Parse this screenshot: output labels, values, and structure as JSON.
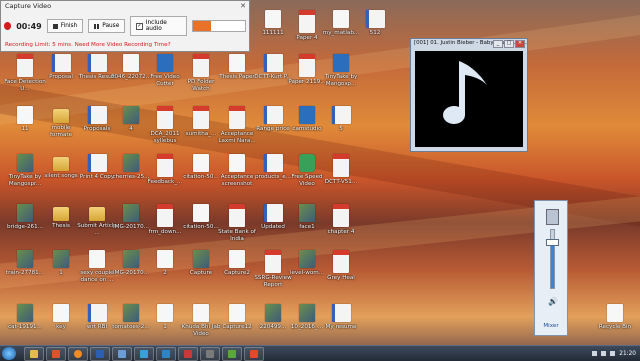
{
  "capture": {
    "title": "Capture Video",
    "timer": "00:49",
    "finish": "Finish",
    "pause": "Pause",
    "include_audio": "Include audio",
    "audio_level": 0.35,
    "limit_notice": "Recording Limit: 5 mins. Need More Video Recording Time?"
  },
  "player": {
    "title": "[001] 01. Justin Bieber - Baby (feat Luda...",
    "colors": {
      "bg": "#000000",
      "note": "#dfe9f5"
    }
  },
  "mixer": {
    "label": "Mixer",
    "level": 0.8
  },
  "desktop_icons": [
    {
      "label": "111111",
      "type": "white"
    },
    {
      "label": "Paper 4",
      "type": "pdf"
    },
    {
      "label": "my_matlab...",
      "type": "white"
    },
    {
      "label": "512",
      "type": "doc"
    },
    {
      "label": "Face Detection U...",
      "type": "pdf"
    },
    {
      "label": "Proposal",
      "type": "doc"
    },
    {
      "label": "Thesis Result",
      "type": "doc"
    },
    {
      "label": "8046_22072...",
      "type": "white"
    },
    {
      "label": "Free Video Cutter",
      "type": "app"
    },
    {
      "label": "PD Folder Watch",
      "type": "pdf"
    },
    {
      "label": "Thesis Paper",
      "type": "white"
    },
    {
      "label": "DCTT-Kurt P...",
      "type": "doc"
    },
    {
      "label": "Paper 2119...",
      "type": "pdf"
    },
    {
      "label": "TinyTake by Mangosp...",
      "type": "app"
    },
    {
      "label": "11",
      "type": "white"
    },
    {
      "label": "mobile formate",
      "type": "folder"
    },
    {
      "label": "Proposals",
      "type": "doc"
    },
    {
      "label": "4",
      "type": "img"
    },
    {
      "label": "DCA_2011 syllebus",
      "type": "pdf"
    },
    {
      "label": "sumitha_...",
      "type": "pdf"
    },
    {
      "label": "Acceptance Laxmi Nara...",
      "type": "pdf"
    },
    {
      "label": "Range price",
      "type": "doc"
    },
    {
      "label": "camstudio",
      "type": "app"
    },
    {
      "label": "5",
      "type": "doc"
    },
    {
      "label": "TinyTake by Mangospr...",
      "type": "img"
    },
    {
      "label": "silent songs",
      "type": "folder"
    },
    {
      "label": "Print 4 Copy",
      "type": "doc"
    },
    {
      "label": "cherries-25...",
      "type": "img"
    },
    {
      "label": "Feedback_...",
      "type": "pdf"
    },
    {
      "label": "citation-50...",
      "type": "white"
    },
    {
      "label": "Acceptance screenshot",
      "type": "white"
    },
    {
      "label": "products_e...",
      "type": "doc"
    },
    {
      "label": "Free Speed Video",
      "type": "green"
    },
    {
      "label": "DCTT-V51...",
      "type": "pdf"
    },
    {
      "label": "bridge-261...",
      "type": "img"
    },
    {
      "label": "Thesis",
      "type": "folder"
    },
    {
      "label": "Submit Article ...",
      "type": "folder"
    },
    {
      "label": "IMG-20170...",
      "type": "img"
    },
    {
      "label": "frm_down...",
      "type": "pdf"
    },
    {
      "label": "citation-50...",
      "type": "white"
    },
    {
      "label": "State Bank of India",
      "type": "pdf"
    },
    {
      "label": "Updated",
      "type": "doc"
    },
    {
      "label": "face1",
      "type": "img"
    },
    {
      "label": "chapter 4",
      "type": "pdf"
    },
    {
      "label": "train-27781...",
      "type": "img"
    },
    {
      "label": "1",
      "type": "img"
    },
    {
      "label": "sexy couple dance on ...",
      "type": "white"
    },
    {
      "label": "IMG-20170...",
      "type": "img"
    },
    {
      "label": "2",
      "type": "white"
    },
    {
      "label": "Capture",
      "type": "img"
    },
    {
      "label": "Capture2",
      "type": "white"
    },
    {
      "label": "SSRG-Review Report",
      "type": "pdf"
    },
    {
      "label": "level-wom...",
      "type": "img"
    },
    {
      "label": "Grey Heal",
      "type": "pdf"
    },
    {
      "label": "cat-19191...",
      "type": "img"
    },
    {
      "label": "key",
      "type": "white"
    },
    {
      "label": "wrt RBI",
      "type": "doc"
    },
    {
      "label": "tomatoes-2...",
      "type": "img"
    },
    {
      "label": "1",
      "type": "white"
    },
    {
      "label": "Khuda Bhi Jab Video",
      "type": "white"
    },
    {
      "label": "Capture12",
      "type": "white"
    },
    {
      "label": "220499...",
      "type": "img"
    },
    {
      "label": "10_2016_...",
      "type": "img"
    },
    {
      "label": "My resume",
      "type": "doc"
    },
    {
      "label": "2017101191...",
      "type": "img"
    },
    {
      "label": "Recycle Bin",
      "type": "white"
    }
  ],
  "tray": {
    "time": "21:20"
  }
}
